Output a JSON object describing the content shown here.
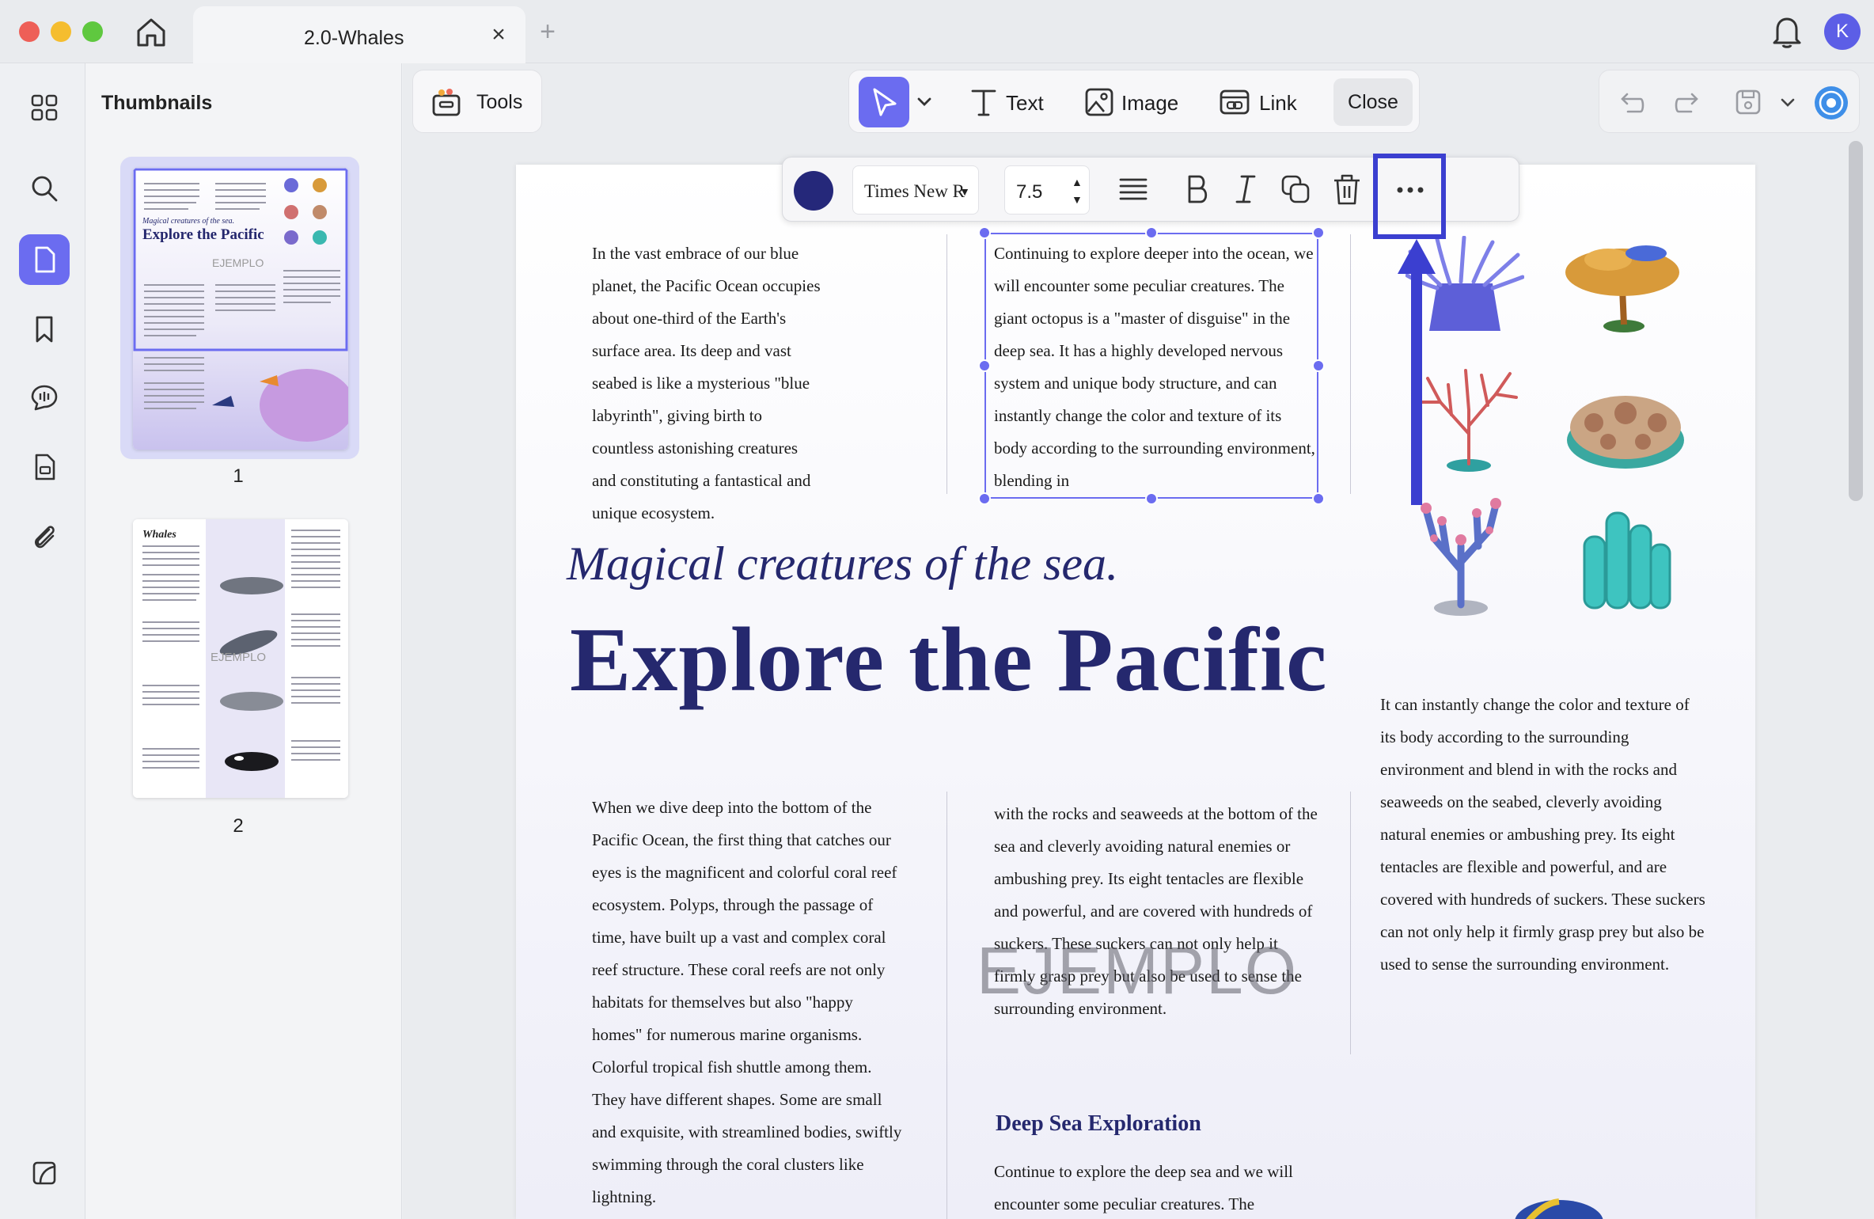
{
  "window": {
    "tab_title": "2.0-Whales",
    "tab_close": "×",
    "tab_add": "+",
    "avatar_initial": "K"
  },
  "sidebar": {
    "title": "Thumbnails",
    "thumbnails": [
      {
        "page": "1",
        "title": "Explore the Pacific",
        "subtitle": "Magical creatures of the sea.",
        "selected": true
      },
      {
        "page": "2",
        "title": "Whales",
        "selected": false
      }
    ],
    "thumb_watermark": "EJEMPLO"
  },
  "toolbar": {
    "tools_label": "Tools",
    "text_label": "Text",
    "image_label": "Image",
    "link_label": "Link",
    "close_label": "Close"
  },
  "format_bar": {
    "color": "#25287a",
    "font_family": "Times New Roman",
    "font_size": "7.5"
  },
  "document": {
    "col1_top": "In the vast embrace of our blue planet, the Pacific Ocean occupies about one-third of the Earth's surface area. Its deep and vast seabed is like a mysterious \"blue labyrinth\", giving birth to countless astonishing creatures and constituting a fantastical and unique ecosystem.",
    "col2_top": "Continuing to explore deeper into the ocean, we will encounter some peculiar creatures. The giant octopus is a \"master of disguise\" in the deep sea. It has a highly developed nervous system and unique body structure, and can instantly change the color and texture of its body according to the surrounding environment, blending in",
    "subtitle": "Magical creatures of the sea.",
    "title": "Explore the Pacific",
    "col1_bottom": "When we dive deep into the bottom of the Pacific Ocean, the first thing that catches our eyes is the magnificent and colorful coral reef ecosystem. Polyps, through the passage of time, have built up a vast and complex coral reef structure. These coral reefs are not only habitats for themselves but also \"happy homes\" for numerous marine organisms. Colorful tropical fish shuttle among them. They have different shapes. Some are small and exquisite, with streamlined bodies, swiftly swimming through the coral clusters like lightning.",
    "col2_bottom": "with the rocks and seaweeds at the bottom of the sea and cleverly avoiding natural enemies or ambushing prey. Its eight tentacles are flexible and powerful, and are covered with hundreds of suckers. These suckers can not only help it firmly grasp prey but also be used to sense the surrounding environment.",
    "col3_right": "It can instantly change the color and texture of its body according to the surrounding environment and blend in with the rocks and seaweeds on the seabed, cleverly avoiding natural enemies or ambushing prey. Its eight tentacles are flexible and powerful, and are covered with hundreds of suckers. These suckers can not only help it firmly grasp prey but also be used to sense the surrounding environment.",
    "heading": "Deep Sea Exploration",
    "col2_last": "Continue to explore the deep sea and we will encounter some peculiar creatures. The",
    "watermark": "EJEMPLO"
  },
  "colors": {
    "accent": "#6b6cf0",
    "title_navy": "#25286e",
    "highlight": "#3b3fd0"
  }
}
